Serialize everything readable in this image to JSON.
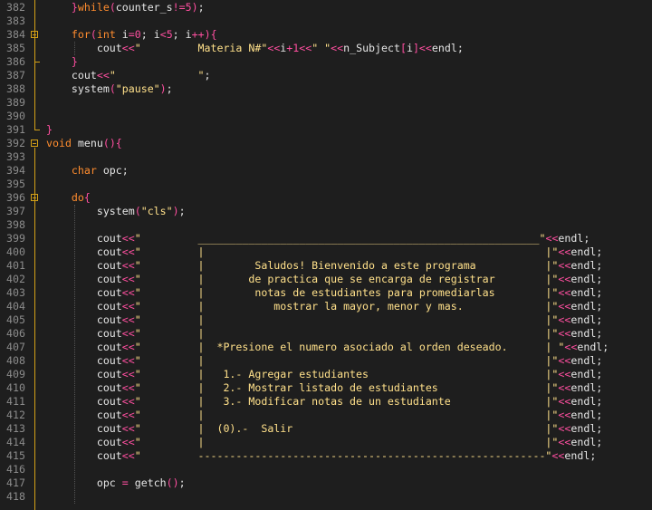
{
  "editor": {
    "lines": [
      {
        "n": "382",
        "fold": false,
        "code": "    }while(counter_s!=5);"
      },
      {
        "n": "383",
        "fold": false,
        "code": ""
      },
      {
        "n": "384",
        "fold": true,
        "code": "    for(int i=0; i<5; i++){"
      },
      {
        "n": "385",
        "fold": false,
        "code": "        cout<<\"         Materia N#\"<<i+1<<\" \"<<n_Subject[i]<<endl;"
      },
      {
        "n": "386",
        "fold": false,
        "code": "    }"
      },
      {
        "n": "387",
        "fold": false,
        "code": "    cout<<\"             \";"
      },
      {
        "n": "388",
        "fold": false,
        "code": "    system(\"pause\");"
      },
      {
        "n": "389",
        "fold": false,
        "code": ""
      },
      {
        "n": "390",
        "fold": false,
        "code": ""
      },
      {
        "n": "391",
        "fold": false,
        "code": "}"
      },
      {
        "n": "392",
        "fold": true,
        "code": "void menu(){"
      },
      {
        "n": "393",
        "fold": false,
        "code": ""
      },
      {
        "n": "394",
        "fold": false,
        "code": "    char opc;"
      },
      {
        "n": "395",
        "fold": false,
        "code": ""
      },
      {
        "n": "396",
        "fold": true,
        "code": "    do{"
      },
      {
        "n": "397",
        "fold": false,
        "code": "        system(\"cls\");"
      },
      {
        "n": "398",
        "fold": false,
        "code": ""
      },
      {
        "n": "399",
        "fold": false,
        "code": "        cout<<\"         ______________________________________________________\"<<endl;"
      },
      {
        "n": "400",
        "fold": false,
        "code": "        cout<<\"         |                                                      |\"<<endl;"
      },
      {
        "n": "401",
        "fold": false,
        "code": "        cout<<\"         |        Saludos! Bienvenido a este programa           |\"<<endl;"
      },
      {
        "n": "402",
        "fold": false,
        "code": "        cout<<\"         |       de practica que se encarga de registrar        |\"<<endl;"
      },
      {
        "n": "403",
        "fold": false,
        "code": "        cout<<\"         |        notas de estudiantes para promediarlas        |\"<<endl;"
      },
      {
        "n": "404",
        "fold": false,
        "code": "        cout<<\"         |           mostrar la mayor, menor y mas.             |\"<<endl;"
      },
      {
        "n": "405",
        "fold": false,
        "code": "        cout<<\"         |                                                      |\"<<endl;"
      },
      {
        "n": "406",
        "fold": false,
        "code": "        cout<<\"         |                                                      |\"<<endl;"
      },
      {
        "n": "407",
        "fold": false,
        "code": "        cout<<\"         |  *Presione el numero asociado al orden deseado.      | \"<<endl;"
      },
      {
        "n": "408",
        "fold": false,
        "code": "        cout<<\"         |                                                      |\"<<endl;"
      },
      {
        "n": "409",
        "fold": false,
        "code": "        cout<<\"         |   1.- Agregar estudiantes                            |\"<<endl;"
      },
      {
        "n": "410",
        "fold": false,
        "code": "        cout<<\"         |   2.- Mostrar listado de estudiantes                 |\"<<endl;"
      },
      {
        "n": "411",
        "fold": false,
        "code": "        cout<<\"         |   3.- Modificar notas de un estudiante               |\"<<endl;"
      },
      {
        "n": "412",
        "fold": false,
        "code": "        cout<<\"         |                                                      |\"<<endl;"
      },
      {
        "n": "413",
        "fold": false,
        "code": "        cout<<\"         |  (0).-  Salir                                        |\"<<endl;"
      },
      {
        "n": "414",
        "fold": false,
        "code": "        cout<<\"         |                                                      |\"<<endl;"
      },
      {
        "n": "415",
        "fold": false,
        "code": "        cout<<\"         -------------------------------------------------------\"<<endl;"
      },
      {
        "n": "416",
        "fold": false,
        "code": ""
      },
      {
        "n": "417",
        "fold": false,
        "code": "        opc = getch();"
      },
      {
        "n": "418",
        "fold": false,
        "code": ""
      }
    ],
    "keywords": [
      "while",
      "for",
      "int",
      "void",
      "char",
      "do"
    ],
    "colors": {
      "background": "#1e1e1e",
      "keyword": "#ff8c2e",
      "string": "#ffe08a",
      "operator": "#ff4fa0",
      "text": "#e6e6e6",
      "line_number": "#8c8c8c",
      "fold_marker": "#d4a017"
    }
  }
}
